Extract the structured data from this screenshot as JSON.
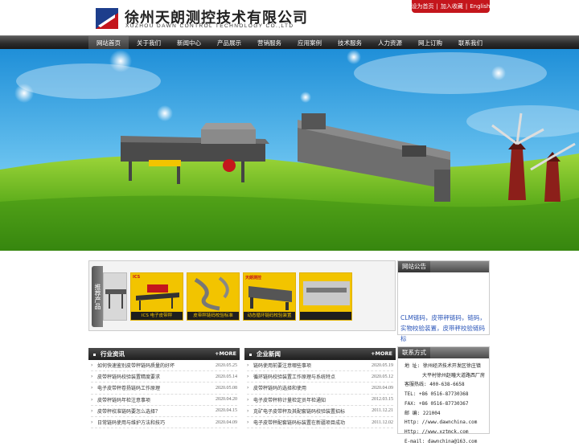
{
  "brand": {
    "name_cn": "徐州天朗测控技术有限公司",
    "name_en": "XUZHOU DAWN CONTROL TECHNOLOGY CO.,LTD",
    "accent": "#c4161c"
  },
  "toplinks": {
    "set_home": "设为首页",
    "sep1": "|",
    "add_fav": "加入收藏",
    "sep2": "|",
    "english": "English"
  },
  "nav": {
    "items": [
      "网站首页",
      "关于我们",
      "新闻中心",
      "产品展示",
      "营销服务",
      "应用案例",
      "技术服务",
      "人力资源",
      "网上订购",
      "联系我们"
    ]
  },
  "banner": {
    "slides": 4,
    "active_slide": 1
  },
  "products": {
    "tab_label": "推荐产品",
    "cards": [
      {
        "top": "",
        "caption": ""
      },
      {
        "top": "ICS",
        "caption": "ICS 电子皮带秤"
      },
      {
        "top": "",
        "caption": "皮带秤链码校验标准"
      },
      {
        "top": "天朗测控",
        "caption": "动态循环链码校验装置"
      },
      {
        "top": "",
        "caption": ""
      }
    ]
  },
  "announce": {
    "title": "网站公告",
    "text": "CLM链码，皮带秤链码，链码，实物校验装置，皮带秤校验链码标"
  },
  "industry": {
    "title": "行业资讯",
    "more": "+MORE",
    "items": [
      {
        "title": "如何快速鉴别皮带秤链码质量的好坏",
        "date": "2020.05.25"
      },
      {
        "title": "皮带秤链码校验装置精度要求",
        "date": "2020.05.14"
      },
      {
        "title": "电子皮带秤卷扬链码工作原理",
        "date": "2020.05.08"
      },
      {
        "title": "皮带秤链码年检注意事项",
        "date": "2020.04.20"
      },
      {
        "title": "皮带秤校准链码要怎么选择？",
        "date": "2020.04.15"
      },
      {
        "title": "日常链码使用与维护方法和技巧",
        "date": "2020.04.09"
      }
    ]
  },
  "company": {
    "title": "企业新闻",
    "more": "+MORE",
    "items": [
      {
        "title": "链码使用前要注意哪些事项",
        "date": "2020.05.19"
      },
      {
        "title": "循环链码校验装置工作原理与系统特点",
        "date": "2020.05.12"
      },
      {
        "title": "皮带秤链码的选择和使用",
        "date": "2020.04.09"
      },
      {
        "title": "电子皮带秤称计量检定员年检通知",
        "date": "2012.03.15"
      },
      {
        "title": "克矿电子皮带秤及其配套链码校验装置招标",
        "date": "2011.12.21"
      },
      {
        "title": "电子皮带秤配套链码标装置在新疆项目成功",
        "date": "2011.12.02"
      }
    ]
  },
  "contact": {
    "title": "联系方式",
    "lines": [
      "地  址: 徐州经济技术开发区徐庄镇",
      "大平村徐州赵疃大道路西厂房",
      "客服热线: 400-638-6658",
      "TEL: +86 0516-87730368",
      "FAX: +86 0516-87730367",
      "邮  编: 221004",
      "Http: //www.dawnchina.com",
      "Http: //www.xztmck.com",
      "E-mail: dawnchina@163.com"
    ]
  }
}
